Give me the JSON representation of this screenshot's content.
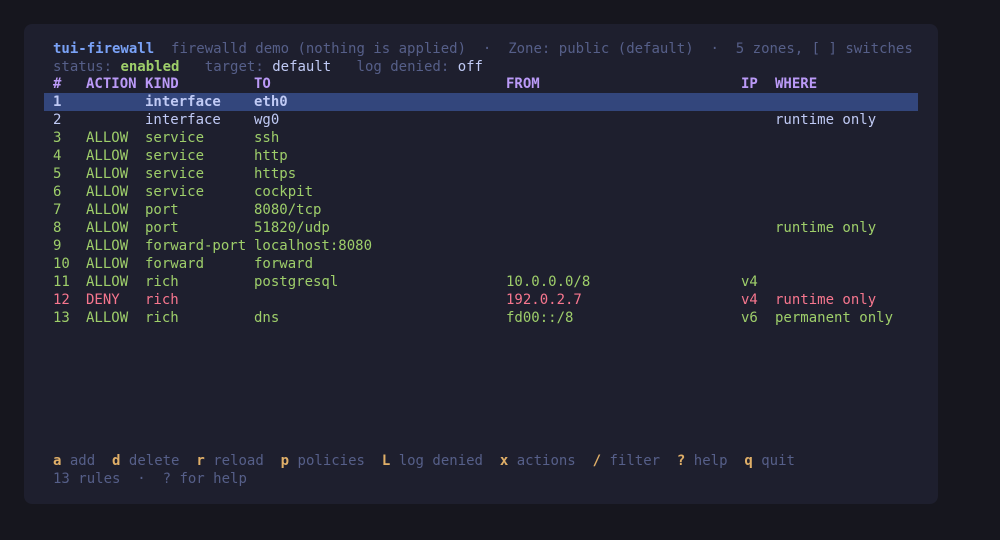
{
  "header": {
    "app_name": "tui-firewall",
    "subtitle": "firewalld demo (nothing is applied)",
    "sep": "·",
    "zone": "Zone: public (default)",
    "zones_info": "5 zones, [ ] switches"
  },
  "status": {
    "status_label": "status:",
    "status_value": "enabled",
    "target_label": "target:",
    "target_value": "default",
    "log_label": "log denied:",
    "log_value": "off"
  },
  "table": {
    "columns": [
      "#",
      "ACTION",
      "KIND",
      "TO",
      "FROM",
      "IP",
      "WHERE"
    ],
    "rows": [
      {
        "num": "1",
        "action": "",
        "kind": "interface",
        "to": "eth0",
        "from": "",
        "ip": "",
        "where": ""
      },
      {
        "num": "2",
        "action": "",
        "kind": "interface",
        "to": "wg0",
        "from": "",
        "ip": "",
        "where": "runtime only"
      },
      {
        "num": "3",
        "action": "ALLOW",
        "kind": "service",
        "to": "ssh",
        "from": "",
        "ip": "",
        "where": ""
      },
      {
        "num": "4",
        "action": "ALLOW",
        "kind": "service",
        "to": "http",
        "from": "",
        "ip": "",
        "where": ""
      },
      {
        "num": "5",
        "action": "ALLOW",
        "kind": "service",
        "to": "https",
        "from": "",
        "ip": "",
        "where": ""
      },
      {
        "num": "6",
        "action": "ALLOW",
        "kind": "service",
        "to": "cockpit",
        "from": "",
        "ip": "",
        "where": ""
      },
      {
        "num": "7",
        "action": "ALLOW",
        "kind": "port",
        "to": "8080/tcp",
        "from": "",
        "ip": "",
        "where": ""
      },
      {
        "num": "8",
        "action": "ALLOW",
        "kind": "port",
        "to": "51820/udp",
        "from": "",
        "ip": "",
        "where": "runtime only"
      },
      {
        "num": "9",
        "action": "ALLOW",
        "kind": "forward-port",
        "to": "localhost:8080",
        "from": "",
        "ip": "",
        "where": ""
      },
      {
        "num": "10",
        "action": "ALLOW",
        "kind": "forward",
        "to": "forward",
        "from": "",
        "ip": "",
        "where": ""
      },
      {
        "num": "11",
        "action": "ALLOW",
        "kind": "rich",
        "to": "postgresql",
        "from": "10.0.0.0/8",
        "ip": "v4",
        "where": ""
      },
      {
        "num": "12",
        "action": "DENY",
        "kind": "rich",
        "to": "",
        "from": "192.0.2.7",
        "ip": "v4",
        "where": "runtime only"
      },
      {
        "num": "13",
        "action": "ALLOW",
        "kind": "rich",
        "to": "dns",
        "from": "fd00::/8",
        "ip": "v6",
        "where": "permanent only"
      }
    ]
  },
  "shortcuts": [
    {
      "key": "a",
      "label": "add"
    },
    {
      "key": "d",
      "label": "delete"
    },
    {
      "key": "r",
      "label": "reload"
    },
    {
      "key": "p",
      "label": "policies"
    },
    {
      "key": "L",
      "label": "log denied"
    },
    {
      "key": "x",
      "label": "actions"
    },
    {
      "key": "/",
      "label": "filter"
    },
    {
      "key": "?",
      "label": "help"
    },
    {
      "key": "q",
      "label": "quit"
    }
  ],
  "footer": {
    "count": "13 rules",
    "sep": "·",
    "hint": "? for help"
  },
  "colors": {
    "background": "#16161e",
    "panel": "#1e1f2e",
    "selection": "#33467c",
    "allow": "#9ece6a",
    "deny": "#f7768e",
    "header": "#bb9af7",
    "key": "#e0af68",
    "title": "#7aa2f7",
    "muted": "#565f89"
  }
}
